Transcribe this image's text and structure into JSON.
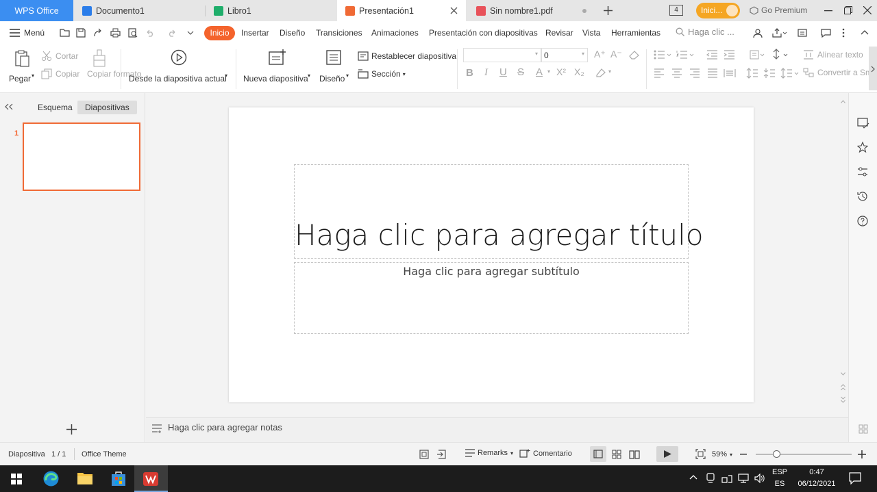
{
  "tabs": [
    {
      "label": "WPS Office"
    },
    {
      "label": "Documento1"
    },
    {
      "label": "Libro1"
    },
    {
      "label": "Presentación1"
    },
    {
      "label": "Sin nombre1.pdf"
    }
  ],
  "window": {
    "tab_count": "4",
    "signin_label": "Inici...",
    "premium_label": "Go Premium"
  },
  "menu": {
    "menu_label": "Menú",
    "tabs": [
      "Inicio",
      "Insertar",
      "Diseño",
      "Transiciones",
      "Animaciones",
      "Presentación con diapositivas",
      "Revisar",
      "Vista",
      "Herramientas"
    ],
    "search_placeholder": "Haga clic ..."
  },
  "ribbon": {
    "paste": "Pegar",
    "cut": "Cortar",
    "copy": "Copiar",
    "format_painter": "Copiar formato",
    "from_current": "Desde la diapositiva actual",
    "new_slide": "Nueva diapositiva",
    "layout": "Diseño",
    "reset_slide": "Restablecer diapositiva",
    "section": "Sección",
    "font_name": "",
    "font_size": "0",
    "align_text": "Alinear texto",
    "convert_smartart": "Convertir a Sm"
  },
  "left_panel": {
    "tab_outline": "Esquema",
    "tab_slides": "Diapositivas",
    "slide_number": "1"
  },
  "slide": {
    "title_placeholder": "Haga clic para agregar título",
    "subtitle_placeholder": "Haga clic para agregar subtítulo"
  },
  "notes": {
    "placeholder": "Haga clic para agregar notas"
  },
  "status": {
    "slide_label": "Diapositiva",
    "slide_count": "1 / 1",
    "theme": "Office Theme",
    "remarks": "Remarks",
    "comment": "Comentario",
    "zoom": "59%",
    "zoom_level": 0.59
  },
  "taskbar": {
    "lang_top": "ESP",
    "lang_bottom": "ES",
    "time": "0:47",
    "date": "06/12/2021"
  },
  "colors": {
    "accent": "#f4632c",
    "wps_blue": "#3b8ef1",
    "writer_blue": "#2b7de9",
    "sheet_green": "#1fae6b",
    "ppt_orange": "#f06a35",
    "pdf_red": "#e8525a",
    "signin_orange": "#f5a623"
  }
}
